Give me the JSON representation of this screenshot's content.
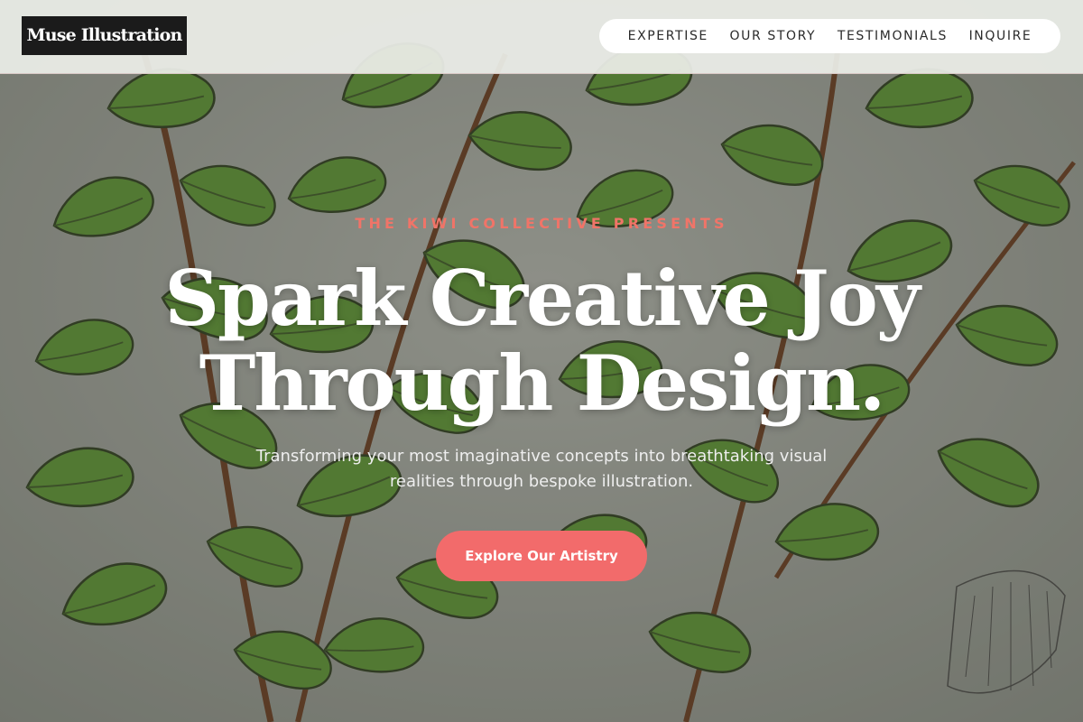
{
  "brand": {
    "logo_text": "Muse Illustration"
  },
  "nav": {
    "items": [
      {
        "label": "EXPERTISE"
      },
      {
        "label": "OUR STORY"
      },
      {
        "label": "TESTIMONIALS"
      },
      {
        "label": "INQUIRE"
      }
    ]
  },
  "hero": {
    "eyebrow": "THE KIWI COLLECTIVE PRESENTS",
    "headline_line1": "Spark Creative Joy",
    "headline_line2": "Through Design.",
    "subtitle": "Transforming your most imaginative concepts into breathtaking visual realities through bespoke illustration.",
    "cta_label": "Explore Our Artistry",
    "background_image": "botanical-fern-illustration"
  },
  "colors": {
    "accent": "#f26b6b",
    "eyebrow": "#f07468",
    "logo_bg": "#1b1b1b",
    "fern_green": "#5f9a2f"
  }
}
